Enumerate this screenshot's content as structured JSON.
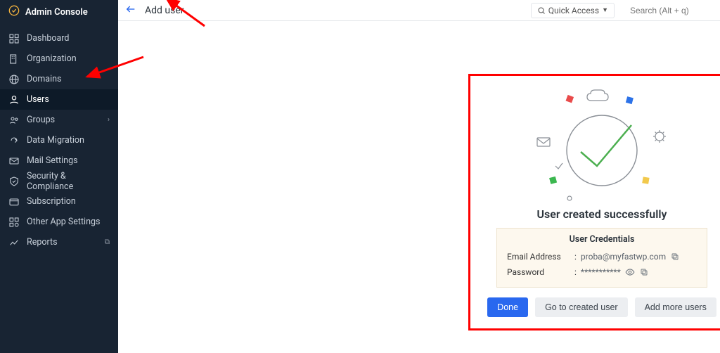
{
  "brand": "Admin Console",
  "topbar": {
    "page_title": "Add user",
    "quick_access": "Quick Access",
    "search_placeholder": "Search (Alt + q)"
  },
  "sidebar": {
    "items": [
      {
        "label": "Dashboard"
      },
      {
        "label": "Organization"
      },
      {
        "label": "Domains"
      },
      {
        "label": "Users"
      },
      {
        "label": "Groups"
      },
      {
        "label": "Data Migration"
      },
      {
        "label": "Mail Settings"
      },
      {
        "label": "Security & Compliance"
      },
      {
        "label": "Subscription"
      },
      {
        "label": "Other App Settings"
      },
      {
        "label": "Reports"
      }
    ]
  },
  "success": {
    "title": "User created successfully",
    "credentials_title": "User Credentials",
    "email_label": "Email Address",
    "email_value": "proba@myfastwp.com",
    "password_label": "Password",
    "password_value": "***********",
    "buttons": {
      "done": "Done",
      "go": "Go to created user",
      "add_more": "Add more users"
    }
  }
}
